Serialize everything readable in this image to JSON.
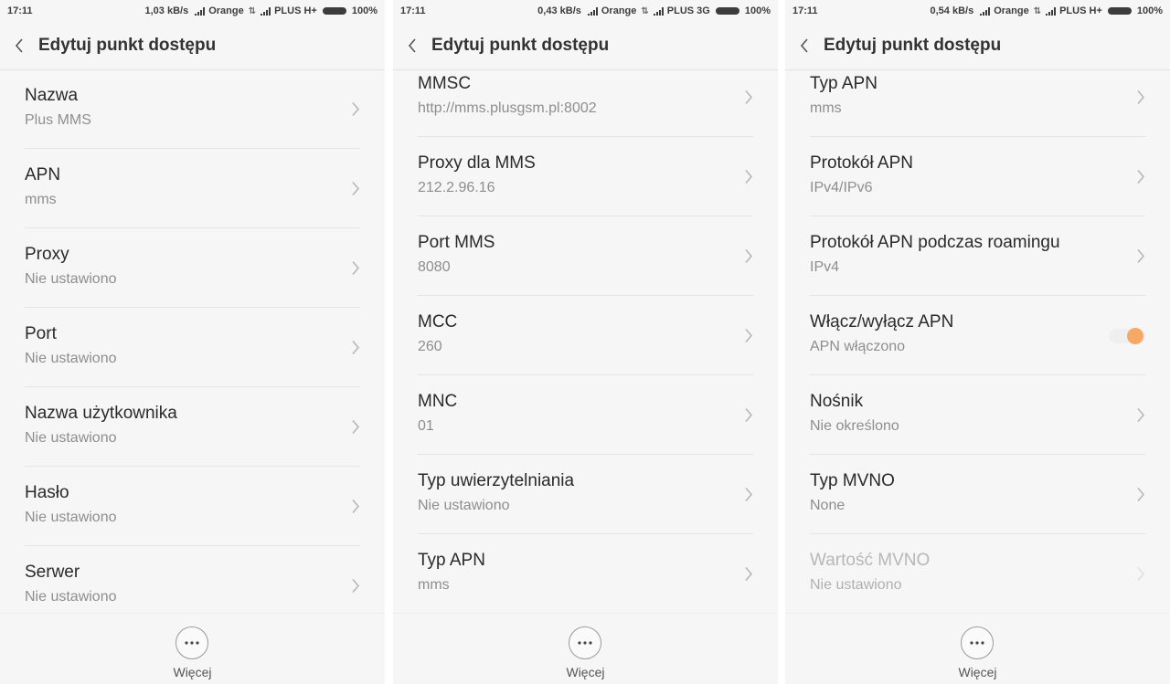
{
  "screens": [
    {
      "status": {
        "time": "17:11",
        "speed": "1,03 kB/s",
        "carrier1": "Orange",
        "carrier2": "PLUS H+",
        "battery": "100%"
      },
      "title": "Edytuj punkt dostępu",
      "items": [
        {
          "title": "Nazwa",
          "value": "Plus MMS"
        },
        {
          "title": "APN",
          "value": "mms"
        },
        {
          "title": "Proxy",
          "value": "Nie ustawiono"
        },
        {
          "title": "Port",
          "value": "Nie ustawiono"
        },
        {
          "title": "Nazwa użytkownika",
          "value": "Nie ustawiono"
        },
        {
          "title": "Hasło",
          "value": "Nie ustawiono"
        },
        {
          "title": "Serwer",
          "value": "Nie ustawiono"
        }
      ],
      "more_label": "Więcej"
    },
    {
      "status": {
        "time": "17:11",
        "speed": "0,43 kB/s",
        "carrier1": "Orange",
        "carrier2": "PLUS 3G",
        "battery": "100%"
      },
      "title": "Edytuj punkt dostępu",
      "items": [
        {
          "title": "MMSC",
          "value": "http://mms.plusgsm.pl:8002"
        },
        {
          "title": "Proxy dla MMS",
          "value": "212.2.96.16"
        },
        {
          "title": "Port MMS",
          "value": "8080"
        },
        {
          "title": "MCC",
          "value": "260"
        },
        {
          "title": "MNC",
          "value": "01"
        },
        {
          "title": "Typ uwierzytelniania",
          "value": "Nie ustawiono"
        },
        {
          "title": "Typ APN",
          "value": "mms"
        }
      ],
      "more_label": "Więcej"
    },
    {
      "status": {
        "time": "17:11",
        "speed": "0,54 kB/s",
        "carrier1": "Orange",
        "carrier2": "PLUS H+",
        "battery": "100%"
      },
      "title": "Edytuj punkt dostępu",
      "items": [
        {
          "title": "Typ APN",
          "value": "mms"
        },
        {
          "title": "Protokół APN",
          "value": "IPv4/IPv6"
        },
        {
          "title": "Protokół APN podczas roamingu",
          "value": "IPv4"
        },
        {
          "title": "Włącz/wyłącz APN",
          "value": "APN włączono",
          "toggle": true,
          "enabled": true
        },
        {
          "title": "Nośnik",
          "value": "Nie określono"
        },
        {
          "title": "Typ MVNO",
          "value": "None"
        },
        {
          "title": "Wartość MVNO",
          "value": "Nie ustawiono"
        }
      ],
      "more_label": "Więcej"
    }
  ],
  "colors": {
    "accent": "#f6a867",
    "title_text": "#2a2a2a",
    "value_text": "#8e8e8e",
    "disabled_text": "#b7b7b7"
  },
  "icons": {
    "back": "chevron-left-icon",
    "row": "chevron-right-icon",
    "more": "more-horizontal-icon"
  }
}
